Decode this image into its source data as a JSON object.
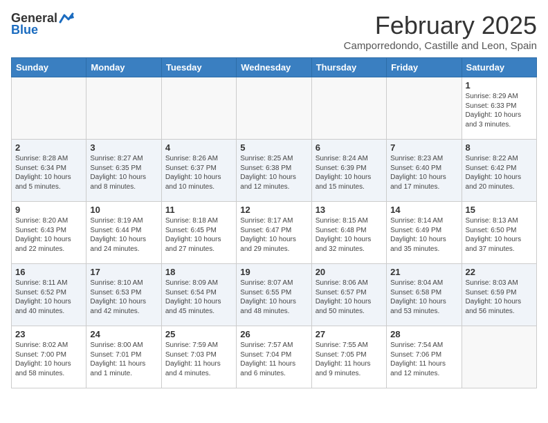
{
  "logo": {
    "general": "General",
    "blue": "Blue"
  },
  "header": {
    "month": "February 2025",
    "location": "Camporredondo, Castille and Leon, Spain"
  },
  "days_of_week": [
    "Sunday",
    "Monday",
    "Tuesday",
    "Wednesday",
    "Thursday",
    "Friday",
    "Saturday"
  ],
  "weeks": [
    [
      {
        "day": "",
        "info": ""
      },
      {
        "day": "",
        "info": ""
      },
      {
        "day": "",
        "info": ""
      },
      {
        "day": "",
        "info": ""
      },
      {
        "day": "",
        "info": ""
      },
      {
        "day": "",
        "info": ""
      },
      {
        "day": "1",
        "info": "Sunrise: 8:29 AM\nSunset: 6:33 PM\nDaylight: 10 hours\nand 3 minutes."
      }
    ],
    [
      {
        "day": "2",
        "info": "Sunrise: 8:28 AM\nSunset: 6:34 PM\nDaylight: 10 hours\nand 5 minutes."
      },
      {
        "day": "3",
        "info": "Sunrise: 8:27 AM\nSunset: 6:35 PM\nDaylight: 10 hours\nand 8 minutes."
      },
      {
        "day": "4",
        "info": "Sunrise: 8:26 AM\nSunset: 6:37 PM\nDaylight: 10 hours\nand 10 minutes."
      },
      {
        "day": "5",
        "info": "Sunrise: 8:25 AM\nSunset: 6:38 PM\nDaylight: 10 hours\nand 12 minutes."
      },
      {
        "day": "6",
        "info": "Sunrise: 8:24 AM\nSunset: 6:39 PM\nDaylight: 10 hours\nand 15 minutes."
      },
      {
        "day": "7",
        "info": "Sunrise: 8:23 AM\nSunset: 6:40 PM\nDaylight: 10 hours\nand 17 minutes."
      },
      {
        "day": "8",
        "info": "Sunrise: 8:22 AM\nSunset: 6:42 PM\nDaylight: 10 hours\nand 20 minutes."
      }
    ],
    [
      {
        "day": "9",
        "info": "Sunrise: 8:20 AM\nSunset: 6:43 PM\nDaylight: 10 hours\nand 22 minutes."
      },
      {
        "day": "10",
        "info": "Sunrise: 8:19 AM\nSunset: 6:44 PM\nDaylight: 10 hours\nand 24 minutes."
      },
      {
        "day": "11",
        "info": "Sunrise: 8:18 AM\nSunset: 6:45 PM\nDaylight: 10 hours\nand 27 minutes."
      },
      {
        "day": "12",
        "info": "Sunrise: 8:17 AM\nSunset: 6:47 PM\nDaylight: 10 hours\nand 29 minutes."
      },
      {
        "day": "13",
        "info": "Sunrise: 8:15 AM\nSunset: 6:48 PM\nDaylight: 10 hours\nand 32 minutes."
      },
      {
        "day": "14",
        "info": "Sunrise: 8:14 AM\nSunset: 6:49 PM\nDaylight: 10 hours\nand 35 minutes."
      },
      {
        "day": "15",
        "info": "Sunrise: 8:13 AM\nSunset: 6:50 PM\nDaylight: 10 hours\nand 37 minutes."
      }
    ],
    [
      {
        "day": "16",
        "info": "Sunrise: 8:11 AM\nSunset: 6:52 PM\nDaylight: 10 hours\nand 40 minutes."
      },
      {
        "day": "17",
        "info": "Sunrise: 8:10 AM\nSunset: 6:53 PM\nDaylight: 10 hours\nand 42 minutes."
      },
      {
        "day": "18",
        "info": "Sunrise: 8:09 AM\nSunset: 6:54 PM\nDaylight: 10 hours\nand 45 minutes."
      },
      {
        "day": "19",
        "info": "Sunrise: 8:07 AM\nSunset: 6:55 PM\nDaylight: 10 hours\nand 48 minutes."
      },
      {
        "day": "20",
        "info": "Sunrise: 8:06 AM\nSunset: 6:57 PM\nDaylight: 10 hours\nand 50 minutes."
      },
      {
        "day": "21",
        "info": "Sunrise: 8:04 AM\nSunset: 6:58 PM\nDaylight: 10 hours\nand 53 minutes."
      },
      {
        "day": "22",
        "info": "Sunrise: 8:03 AM\nSunset: 6:59 PM\nDaylight: 10 hours\nand 56 minutes."
      }
    ],
    [
      {
        "day": "23",
        "info": "Sunrise: 8:02 AM\nSunset: 7:00 PM\nDaylight: 10 hours\nand 58 minutes."
      },
      {
        "day": "24",
        "info": "Sunrise: 8:00 AM\nSunset: 7:01 PM\nDaylight: 11 hours\nand 1 minute."
      },
      {
        "day": "25",
        "info": "Sunrise: 7:59 AM\nSunset: 7:03 PM\nDaylight: 11 hours\nand 4 minutes."
      },
      {
        "day": "26",
        "info": "Sunrise: 7:57 AM\nSunset: 7:04 PM\nDaylight: 11 hours\nand 6 minutes."
      },
      {
        "day": "27",
        "info": "Sunrise: 7:55 AM\nSunset: 7:05 PM\nDaylight: 11 hours\nand 9 minutes."
      },
      {
        "day": "28",
        "info": "Sunrise: 7:54 AM\nSunset: 7:06 PM\nDaylight: 11 hours\nand 12 minutes."
      },
      {
        "day": "",
        "info": ""
      }
    ]
  ]
}
